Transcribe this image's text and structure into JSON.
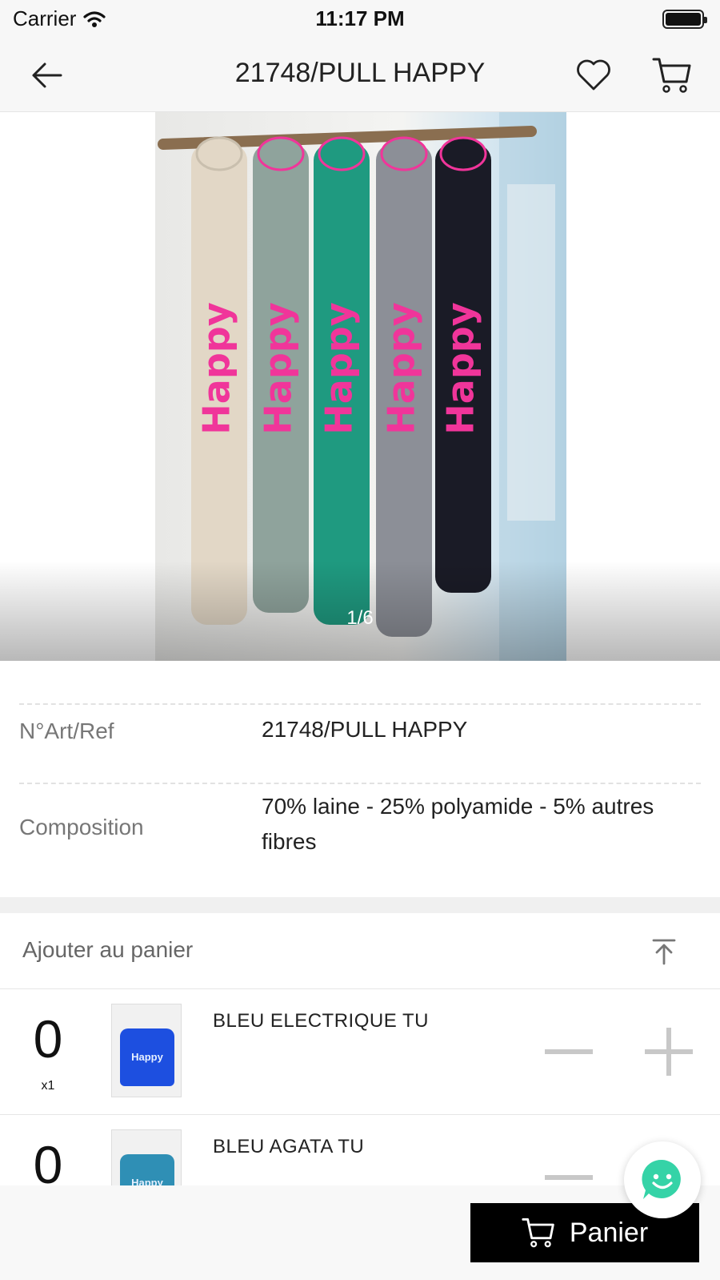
{
  "status_bar": {
    "carrier": "Carrier",
    "time": "11:17 PM"
  },
  "nav": {
    "title": "21748/PULL HAPPY",
    "back_icon": "arrow-left-icon",
    "favorite_icon": "heart-icon",
    "cart_icon": "cart-icon"
  },
  "gallery": {
    "counter": "1/6",
    "image_text": "Happy",
    "sweater_colors": [
      "#e2d7c6",
      "#8fa39c",
      "#1f9a80",
      "#8c8f97",
      "#1a1b26"
    ],
    "accent_color": "#f0359a"
  },
  "details": [
    {
      "label": "N°Art/Ref",
      "value": "21748/PULL HAPPY"
    },
    {
      "label": "Composition",
      "value": "70% laine - 25% polyamide - 5% autres fibres"
    }
  ],
  "add_to_cart": {
    "title": "Ajouter au panier",
    "scroll_top_icon": "arrow-up-to-top-icon",
    "variants": [
      {
        "quantity": "0",
        "multiplier": "x1",
        "name": "BLEU ELECTRIQUE TU",
        "thumb_color": "#1d4fe0",
        "thumb_text": "Happy"
      },
      {
        "quantity": "0",
        "multiplier": "",
        "name": "BLEU AGATA TU",
        "thumb_color": "#2f8fb5",
        "thumb_text": "Happy"
      }
    ]
  },
  "bottom_bar": {
    "cart_button_label": "Panier",
    "chat_icon": "chat-smile-icon",
    "chat_color": "#35d3a7"
  }
}
